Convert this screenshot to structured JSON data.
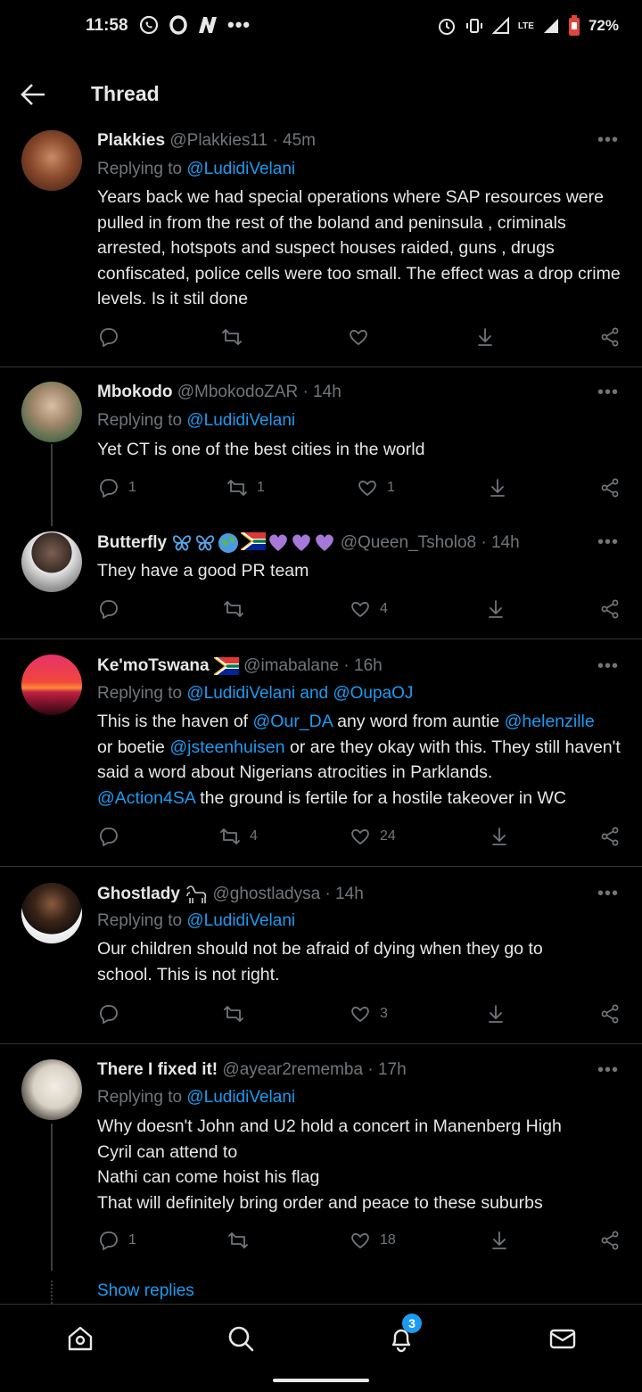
{
  "status_bar": {
    "time": "11:58",
    "battery": "72%",
    "network": "LTE"
  },
  "header": {
    "title": "Thread"
  },
  "tweets": [
    {
      "name": "Plakkies",
      "handle": "@Plakkies11",
      "time": "· 45m",
      "reply_prefix": "Replying to",
      "reply_to": "@LudidiVelani",
      "text": "Years back we had special operations where SAP resources were pulled in from the rest of the boland and peninsula , criminals arrested, hotspots and suspect houses raided, guns , drugs  confiscated, police cells were too small. The  effect was a drop crime levels. Is it stil done",
      "replies": "",
      "retweets": "",
      "likes": ""
    },
    {
      "name": "Mbokodo",
      "handle": "@MbokodoZAR",
      "time": "· 14h",
      "reply_prefix": "Replying to",
      "reply_to": "@LudidiVelani",
      "text": "Yet CT is one of the best cities in the world",
      "replies": "1",
      "retweets": "1",
      "likes": "1"
    },
    {
      "name": "Butterfly",
      "handle": "@Queen_Tsholo8",
      "time": "· 14h",
      "text": "They have a good PR team",
      "replies": "",
      "retweets": "",
      "likes": "4"
    },
    {
      "name": "Ke'moTswana",
      "handle": "@imabalane",
      "time": "· 16h",
      "reply_prefix": "Replying to",
      "reply_to": "@LudidiVelani and @OupaOJ",
      "text_parts": {
        "p1": "This is the haven of ",
        "m1": "@Our_DA",
        "p2": " any word from auntie ",
        "m2": "@helenzille",
        "p3": "or boetie ",
        "m3": "@jsteenhuisen",
        "p4": " or are they okay with this. They still haven't said a word about Nigerians atrocities in Parklands.",
        "m4": "@Action4SA",
        "p5": " the ground is fertile for a hostile takeover in WC"
      },
      "replies": "",
      "retweets": "4",
      "likes": "24"
    },
    {
      "name": "Ghostlady",
      "handle": "@ghostladysa",
      "time": "· 14h",
      "reply_prefix": "Replying to",
      "reply_to": "@LudidiVelani",
      "text": "Our children should not be afraid of dying when they go to school. This is not right.",
      "replies": "",
      "retweets": "",
      "likes": "3"
    },
    {
      "name": "There I fixed it!",
      "handle": "@ayear2rememba",
      "time": "· 17h",
      "reply_prefix": "Replying to",
      "reply_to": "@LudidiVelani",
      "lines": [
        "Why doesn't John and U2 hold a concert in Manenberg High",
        "Cyril can attend to",
        "Nathi can come hoist his flag",
        "That will definitely bring order and peace to these suburbs"
      ],
      "replies": "1",
      "retweets": "",
      "likes": "18"
    }
  ],
  "show_replies": "Show replies",
  "nav": {
    "notifications_badge": "3"
  },
  "colors": {
    "accent": "#1d9bf0",
    "background": "#000000",
    "muted": "#71767b",
    "text": "#e7e7e7"
  }
}
